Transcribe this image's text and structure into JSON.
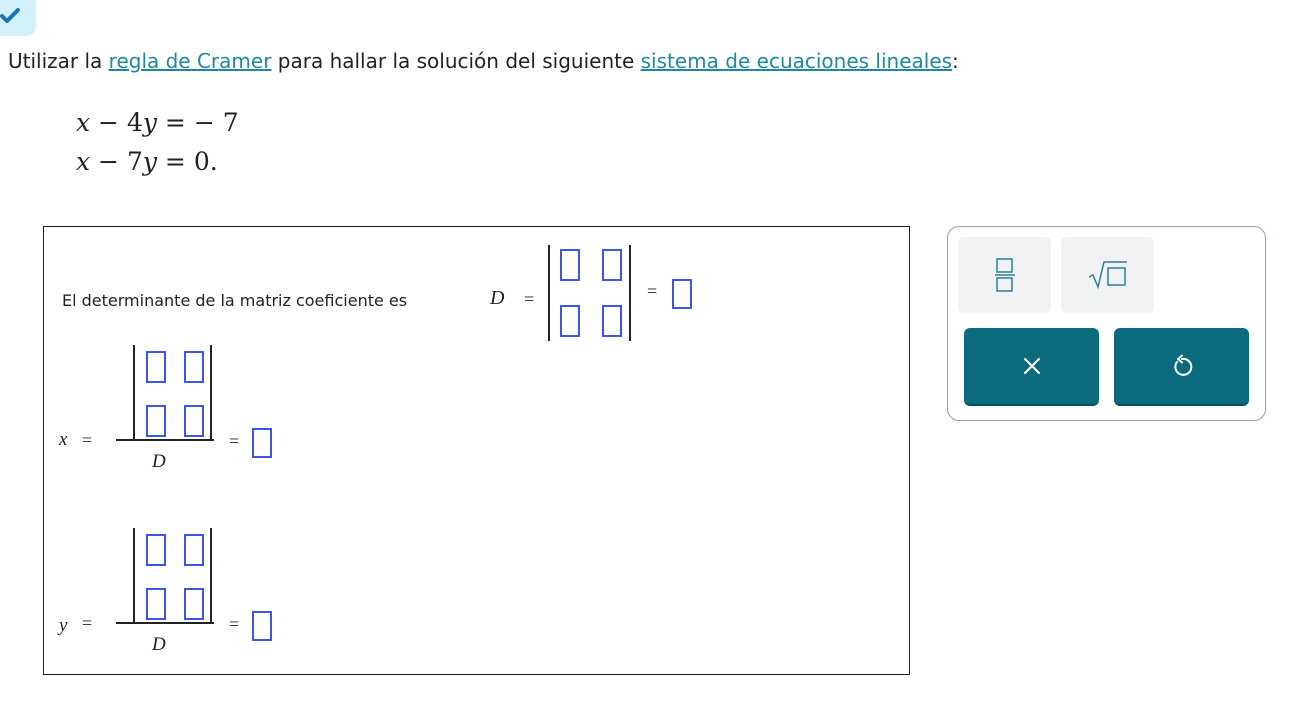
{
  "status": {
    "icon": "checkmark-icon"
  },
  "prompt": {
    "before": "Utilizar la ",
    "link1": "regla de Cramer",
    "middle": " para hallar la solución del siguiente ",
    "link2": "sistema de ecuaciones lineales",
    "after": ":"
  },
  "equations": {
    "eq1": {
      "x": "x",
      "minus": " − 4",
      "y": "y",
      "rhs": " = − 7"
    },
    "eq2": {
      "x": "x",
      "minus": " − 7",
      "y": "y",
      "rhs": " = 0."
    }
  },
  "work": {
    "det_label": "El determinante de la matriz coeficiente es",
    "D": "D",
    "eq": "=",
    "x_var": "x",
    "y_var": "y"
  },
  "toolbar": {
    "fraction_icon": "fraction-template-icon",
    "sqrt_icon": "square-root-template-icon",
    "clear_icon": "close-icon",
    "undo_icon": "undo-icon"
  },
  "colors": {
    "accent": "#0b6b7c",
    "slot": "#3b55e6",
    "link": "#1f8a9c"
  }
}
